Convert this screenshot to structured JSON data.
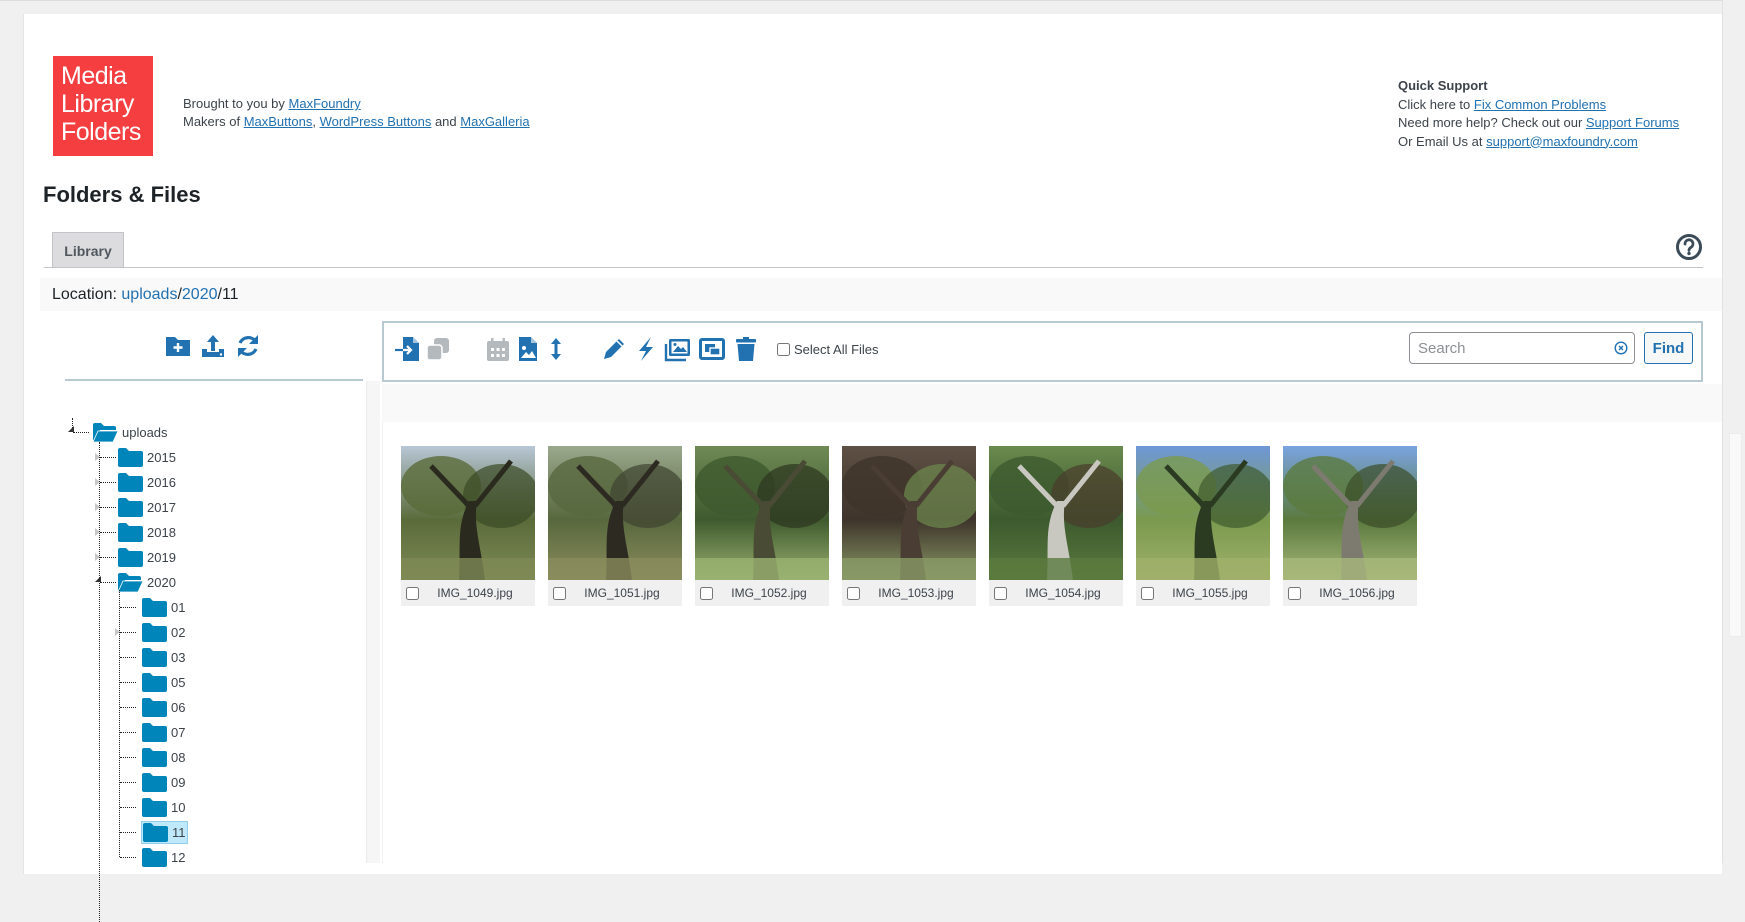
{
  "logo": {
    "lines": [
      "Media",
      "Library",
      "Folders"
    ],
    "bg_color": "#f43e3f"
  },
  "header": {
    "brought_prefix": "Brought to you by ",
    "brought_link": "MaxFoundry",
    "makers_prefix": "Makers of ",
    "makers_link1": "MaxButtons",
    "makers_sep": ", ",
    "makers_link2": "WordPress Buttons",
    "makers_and": " and ",
    "makers_link3": "MaxGalleria"
  },
  "support": {
    "title": "Quick Support",
    "line1_prefix": "Click here to ",
    "line1_link": "Fix Common Problems",
    "line2_prefix": "Need more help? Check out our ",
    "line2_link": "Support Forums",
    "line3_prefix": "Or Email Us at ",
    "line3_link": "support@maxfoundry.com"
  },
  "page_title": "Folders & Files",
  "tabs": [
    {
      "label": "Library",
      "active": true
    }
  ],
  "help_icon": "question-circle-icon",
  "location": {
    "label": "Location: ",
    "crumbs": [
      "uploads",
      "2020"
    ],
    "sep": "/",
    "current": "11"
  },
  "tree_toolbar": [
    {
      "icon": "add-folder-icon",
      "color": "#2271b1"
    },
    {
      "icon": "upload-icon",
      "color": "#2271b1"
    },
    {
      "icon": "sync-icon",
      "color": "#2271b1"
    }
  ],
  "tree": {
    "root": "uploads",
    "years": [
      "2015",
      "2016",
      "2017",
      "2018",
      "2019",
      "2020"
    ],
    "expanded_year": "2020",
    "months": [
      "01",
      "02",
      "03",
      "05",
      "06",
      "07",
      "08",
      "09",
      "10",
      "11",
      "12"
    ],
    "selected": "11",
    "folder_color": "#0085ba"
  },
  "file_toolbar": {
    "icons": [
      {
        "name": "move-copy-icon",
        "enabled": true
      },
      {
        "name": "duplicate-icon",
        "enabled": false
      },
      {
        "name": "calendar-icon",
        "enabled": false
      },
      {
        "name": "image-file-icon",
        "enabled": true
      },
      {
        "name": "sort-icon",
        "enabled": true
      },
      {
        "name": "rename-pencil-icon",
        "enabled": true
      },
      {
        "name": "lightning-icon",
        "enabled": true
      },
      {
        "name": "gallery-icon",
        "enabled": true
      },
      {
        "name": "regenerate-thumbnails-icon",
        "enabled": true
      },
      {
        "name": "trash-icon",
        "enabled": true
      }
    ],
    "select_all_label": "Select All Files",
    "search_placeholder": "Search",
    "search_value": "",
    "find_label": "Find",
    "accent_color": "#2271b1",
    "disabled_color": "#b4b9be"
  },
  "files": [
    {
      "name": "IMG_1049.jpg",
      "checked": false
    },
    {
      "name": "IMG_1051.jpg",
      "checked": false
    },
    {
      "name": "IMG_1052.jpg",
      "checked": false
    },
    {
      "name": "IMG_1053.jpg",
      "checked": false
    },
    {
      "name": "IMG_1054.jpg",
      "checked": false
    },
    {
      "name": "IMG_1055.jpg",
      "checked": false
    },
    {
      "name": "IMG_1056.jpg",
      "checked": false
    }
  ]
}
